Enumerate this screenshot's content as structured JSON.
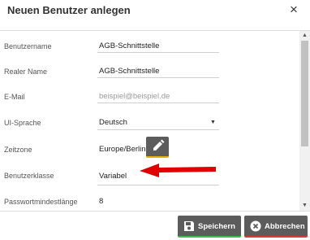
{
  "dialog": {
    "title": "Neuen Benutzer anlegen",
    "close_icon": "×"
  },
  "form": {
    "fields": [
      {
        "label": "Benutzername",
        "value": "AGB-Schnittstelle"
      },
      {
        "label": "Realer Name",
        "value": "AGB-Schnittstelle"
      },
      {
        "label": "E-Mail",
        "value": "",
        "placeholder": "beispiel@beispiel.de"
      },
      {
        "label": "UI-Sprache",
        "value": "Deutsch",
        "type": "select"
      },
      {
        "label": "Zeitzone",
        "value": "Europe/Berlin"
      },
      {
        "label": "Benutzerklasse",
        "value": "Variabel"
      },
      {
        "label": "Passwortmindestlänge",
        "value": "8"
      }
    ]
  },
  "icons": {
    "edit": "pencil-icon",
    "save": "floppy-disk-icon",
    "cancel": "cancel-circle-icon",
    "annotation": "red-arrow"
  },
  "buttons": {
    "save_label": "Speichern",
    "cancel_label": "Abbrechen"
  },
  "colors": {
    "button_bg": "#5c5c5c",
    "save_accent": "#3fb950",
    "cancel_accent": "#d93b3b",
    "edit_accent": "#e8b000",
    "arrow": "#e00000"
  }
}
